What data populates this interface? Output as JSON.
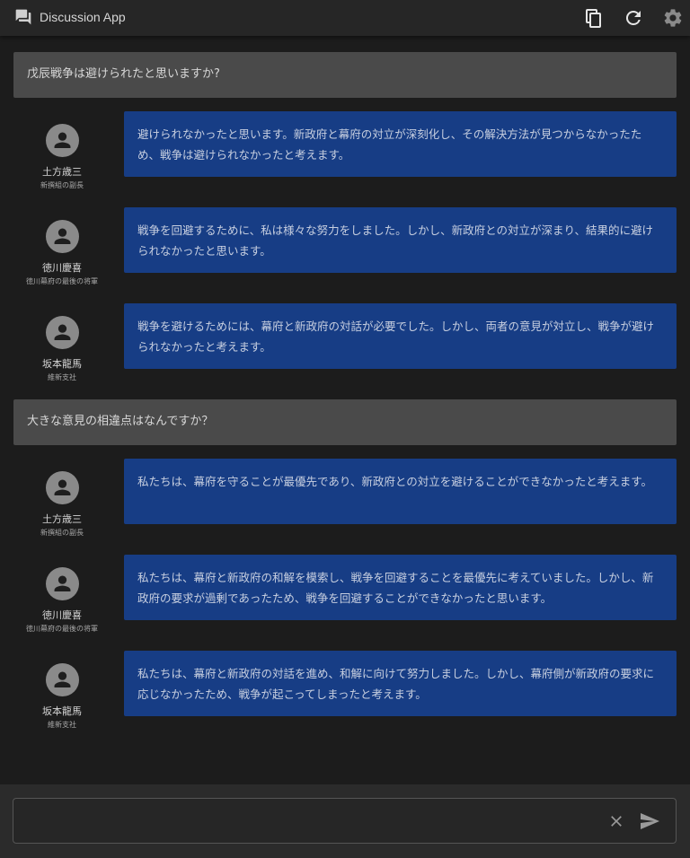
{
  "app": {
    "title": "Discussion App"
  },
  "icons": {
    "logo": "forum-icon",
    "copy": "copy-icon",
    "refresh": "refresh-icon",
    "settings": "gear-icon",
    "avatar": "person-icon",
    "clear": "close-icon",
    "send": "send-icon"
  },
  "colors": {
    "header_bg": "#262626",
    "page_bg": "#1c1c1c",
    "question_bg": "#4a4a4a",
    "bubble_bg": "#173d85"
  },
  "threads": [
    {
      "question": "戊辰戦争は避けられたと思いますか?",
      "responses": [
        {
          "name": "土方歳三",
          "role": "新撰組の副長",
          "text": "避けられなかったと思います。新政府と幕府の対立が深刻化し、その解決方法が見つからなかったため、戦争は避けられなかったと考えます。"
        },
        {
          "name": "徳川慶喜",
          "role": "徳川幕府の最後の将軍",
          "text": "戦争を回避するために、私は様々な努力をしました。しかし、新政府との対立が深まり、結果的に避けられなかったと思います。"
        },
        {
          "name": "坂本龍馬",
          "role": "維新支社",
          "text": "戦争を避けるためには、幕府と新政府の対話が必要でした。しかし、両者の意見が対立し、戦争が避けられなかったと考えます。"
        }
      ]
    },
    {
      "question": "大きな意見の相違点はなんですか？",
      "responses": [
        {
          "name": "土方歳三",
          "role": "新撰組の副長",
          "text": "私たちは、幕府を守ることが最優先であり、新政府との対立を避けることができなかったと考えます。"
        },
        {
          "name": "徳川慶喜",
          "role": "徳川幕府の最後の将軍",
          "text": "私たちは、幕府と新政府の和解を模索し、戦争を回避することを最優先に考えていました。しかし、新政府の要求が過剰であったため、戦争を回避することができなかったと思います。"
        },
        {
          "name": "坂本龍馬",
          "role": "維新支社",
          "text": "私たちは、幕府と新政府の対話を進め、和解に向けて努力しました。しかし、幕府側が新政府の要求に応じなかったため、戦争が起こってしまったと考えます。"
        }
      ]
    }
  ],
  "input": {
    "value": "",
    "placeholder": ""
  }
}
